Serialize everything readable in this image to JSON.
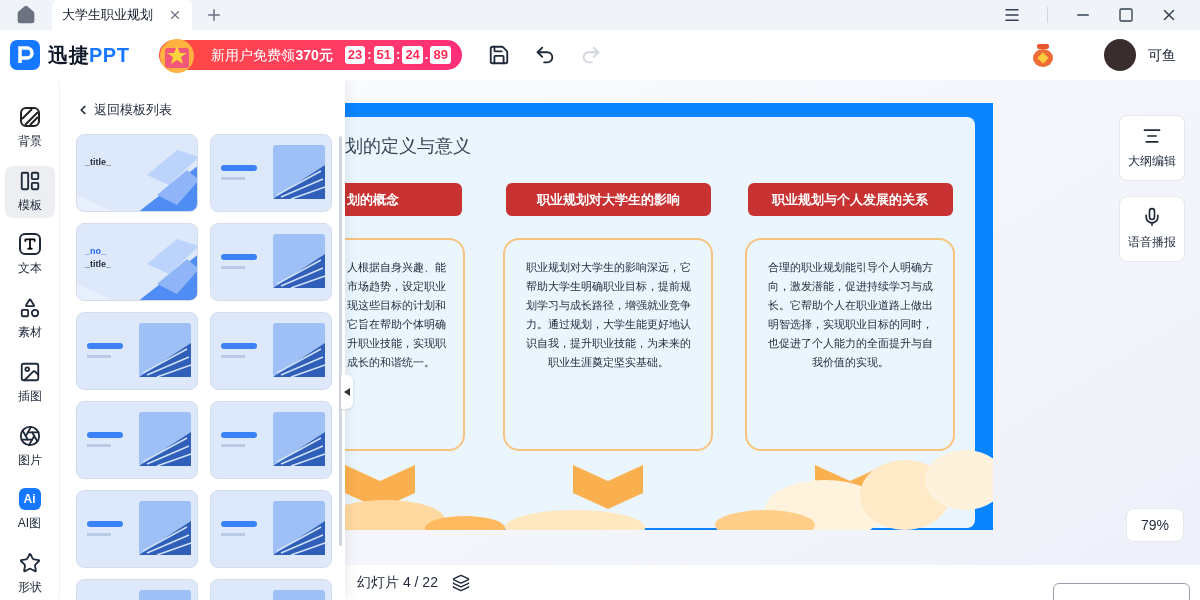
{
  "tabs": [
    {
      "label": "大学生职业规划",
      "selected": true
    }
  ],
  "header": {
    "logo_text": "迅捷",
    "logo_accent": "PPT",
    "promo": {
      "text": "新用户免费领**370元**",
      "timer": [
        "23",
        "51",
        "24",
        "89"
      ],
      "separators": [
        ":",
        ":",
        "."
      ]
    },
    "history": [
      {
        "kind": "undo",
        "disabled": false
      },
      {
        "kind": "redo",
        "disabled": true
      }
    ],
    "user": "可鱼"
  },
  "toolbar": [
    {
      "kind": "background",
      "label": "背景",
      "selected": false
    },
    {
      "kind": "template",
      "label": "模板",
      "selected": true
    },
    {
      "kind": "text",
      "label": "文本",
      "selected": false
    },
    {
      "kind": "material",
      "label": "素材",
      "selected": false
    },
    {
      "kind": "illustration",
      "label": "插图",
      "selected": false
    },
    {
      "kind": "image",
      "label": "图片",
      "selected": false
    },
    {
      "kind": "ai",
      "label": "AI图",
      "badge": "Ai",
      "selected": false
    },
    {
      "kind": "shape",
      "label": "形状",
      "selected": false
    }
  ],
  "template_panel": {
    "back": "返回模板列表",
    "thumbnails": [
      {
        "kind": "glass",
        "texts": [
          "_title_"
        ]
      },
      {
        "kind": "building"
      },
      {
        "kind": "glass",
        "texts": [
          "_no_",
          "_title_"
        ]
      },
      {
        "kind": "building"
      },
      {
        "kind": "building"
      },
      {
        "kind": "building"
      },
      {
        "kind": "building"
      },
      {
        "kind": "building"
      },
      {
        "kind": "building"
      },
      {
        "kind": "building"
      },
      {
        "kind": "building"
      },
      {
        "kind": "building"
      }
    ]
  },
  "slide": {
    "title": "划的定义与意义",
    "columns": [
      {
        "heading": "划的概念",
        "lines": [
          "人根据自身兴趣、能",
          "市场趋势，设定职业",
          "现这些目标的计划和",
          "它旨在帮助个体明确",
          "升职业技能，实现职",
          "成长的和谐统一。"
        ]
      },
      {
        "heading": "职业规划对大学生的影响",
        "lines": [
          "职业规划对大学生的影响深远，它",
          "帮助大学生明确职业目标，提前规",
          "划学习与成长路径，增强就业竞争",
          "力。通过规划，大学生能更好地认",
          "识自我，提升职业技能，为未来的",
          "职业生涯奠定坚实基础。"
        ]
      },
      {
        "heading": "职业规划与个人发展的关系",
        "lines": [
          "合理的职业规划能引导个人明确方",
          "向，激发潜能，促进持续学习与成",
          "长。它帮助个人在职业道路上做出",
          "明智选择，实现职业目标的同时，",
          "也促进了个人能力的全面提升与自",
          "我价值的实现。"
        ]
      }
    ]
  },
  "side_tools": [
    "大纲编辑",
    "语音播报"
  ],
  "zoom": "79%",
  "status": {
    "slide_label": "幻灯片",
    "current": "4",
    "separator": "/",
    "total": "22"
  }
}
